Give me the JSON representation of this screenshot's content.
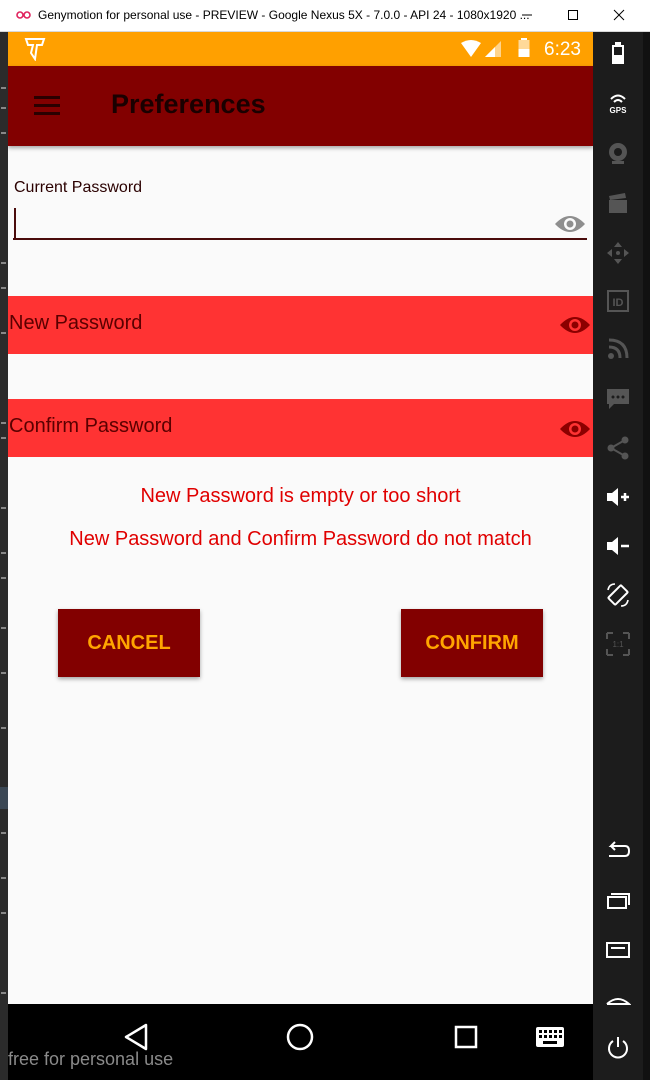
{
  "window": {
    "title": "Genymotion for personal use - PREVIEW - Google Nexus 5X - 7.0.0 - API 24 - 1080x1920 ..."
  },
  "status_bar": {
    "time": "6:23",
    "icons": [
      "app-shield-icon",
      "wifi-icon",
      "signal-icon",
      "battery-icon"
    ]
  },
  "toolbar": {
    "title": "Preferences",
    "menu_icon": "hamburger-menu-icon"
  },
  "form": {
    "current_password": {
      "label": "Current Password",
      "value": ""
    },
    "new_password": {
      "placeholder": "New Password"
    },
    "confirm_password": {
      "placeholder": "Confirm Password"
    },
    "errors": [
      "New Password is empty or too short",
      "New Password and Confirm Password do not match"
    ],
    "cancel_label": "CANCEL",
    "confirm_label": "CONFIRM"
  },
  "nav_bar": {
    "buttons": [
      "back-icon",
      "home-icon",
      "recents-icon",
      "keyboard-icon"
    ]
  },
  "side_panel": {
    "buttons": [
      "battery-icon",
      "gps-icon",
      "camera-icon",
      "video-icon",
      "dpad-icon",
      "id-icon",
      "rss-icon",
      "message-icon",
      "share-icon",
      "volume-up-icon",
      "volume-down-icon",
      "rotate-icon",
      "scale-icon",
      "back-icon",
      "recent-apps-icon",
      "menu-icon",
      "home-icon",
      "power-icon"
    ],
    "gps_label": "GPS",
    "id_label": "ID",
    "scale_label": "1:1"
  },
  "watermark": "free for personal use",
  "colors": {
    "status_bar": "#ffa000",
    "toolbar": "#820000",
    "field_error_bg": "#ff3333",
    "error_text": "#e00000",
    "button_bg": "#820000",
    "button_text": "#ffa500"
  }
}
